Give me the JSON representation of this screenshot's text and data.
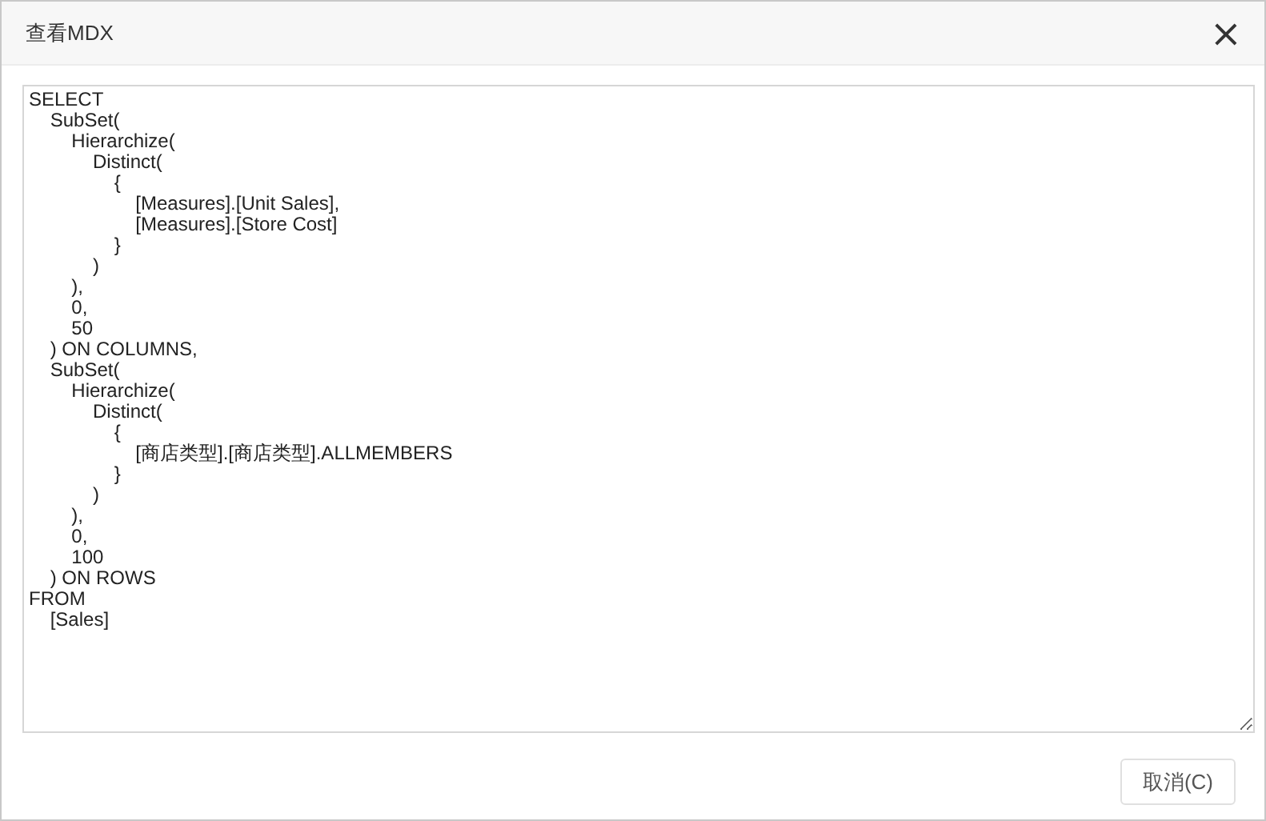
{
  "dialog": {
    "title": "查看MDX",
    "close_icon": "×"
  },
  "editor": {
    "value": "SELECT\n    SubSet(\n        Hierarchize(\n            Distinct(\n                {\n                    [Measures].[Unit Sales],\n                    [Measures].[Store Cost]\n                }\n            )\n        ),\n        0,\n        50\n    ) ON COLUMNS,\n    SubSet(\n        Hierarchize(\n            Distinct(\n                {\n                    [商店类型].[商店类型].ALLMEMBERS\n                }\n            )\n        ),\n        0,\n        100\n    ) ON ROWS\nFROM\n    [Sales]"
  },
  "buttons": [
    "取消(C)"
  ]
}
